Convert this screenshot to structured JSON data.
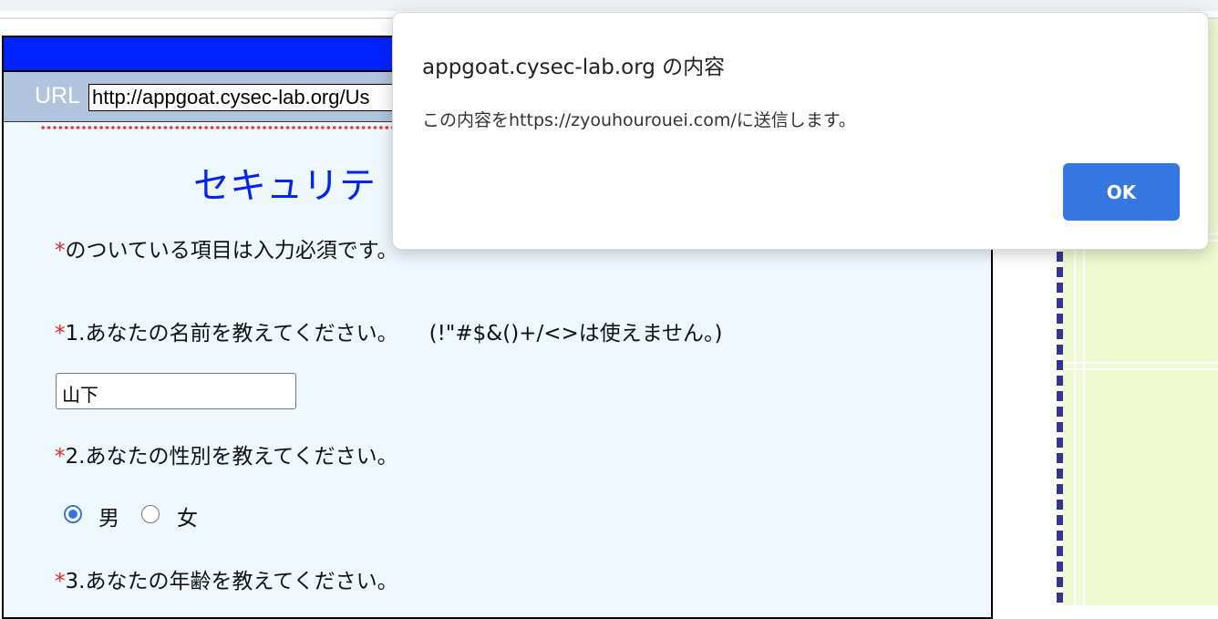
{
  "page": {
    "url_label": "URL",
    "url_value": "http://appgoat.cysec-lab.org/Us",
    "title": "セキュリテ",
    "required_mark": "*",
    "required_note": "のついている項目は入力必須です。",
    "q1": "1.あなたの名前を教えてください。",
    "q1_note": "(!\"#$&()+/<>は使えません。)",
    "name_value": "山下",
    "q2": "2.あなたの性別を教えてください。",
    "gender_options": [
      {
        "label": "男",
        "selected": true
      },
      {
        "label": "女",
        "selected": false
      }
    ],
    "q3": "3.あなたの年齢を教えてください。"
  },
  "dialog": {
    "title": "appgoat.cysec-lab.org の内容",
    "message": "この内容をhttps://zyouhourouei.com/に送信します。",
    "ok_label": "OK"
  }
}
